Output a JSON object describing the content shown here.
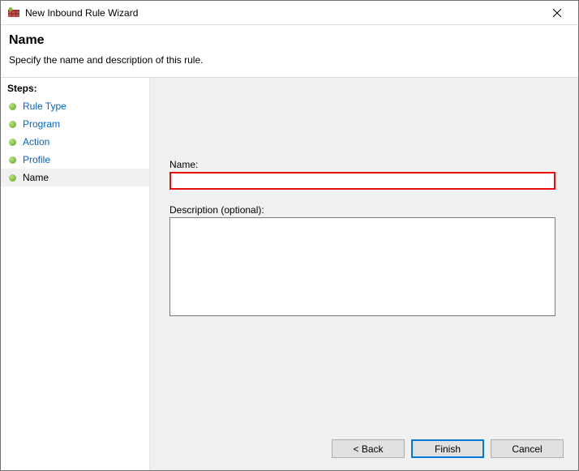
{
  "window": {
    "title": "New Inbound Rule Wizard"
  },
  "header": {
    "title": "Name",
    "subtitle": "Specify the name and description of this rule."
  },
  "sidebar": {
    "header": "Steps:",
    "items": [
      {
        "label": "Rule Type"
      },
      {
        "label": "Program"
      },
      {
        "label": "Action"
      },
      {
        "label": "Profile"
      },
      {
        "label": "Name"
      }
    ]
  },
  "form": {
    "name_label": "Name:",
    "name_value": "",
    "desc_label": "Description (optional):",
    "desc_value": ""
  },
  "buttons": {
    "back": "< Back",
    "finish": "Finish",
    "cancel": "Cancel"
  }
}
